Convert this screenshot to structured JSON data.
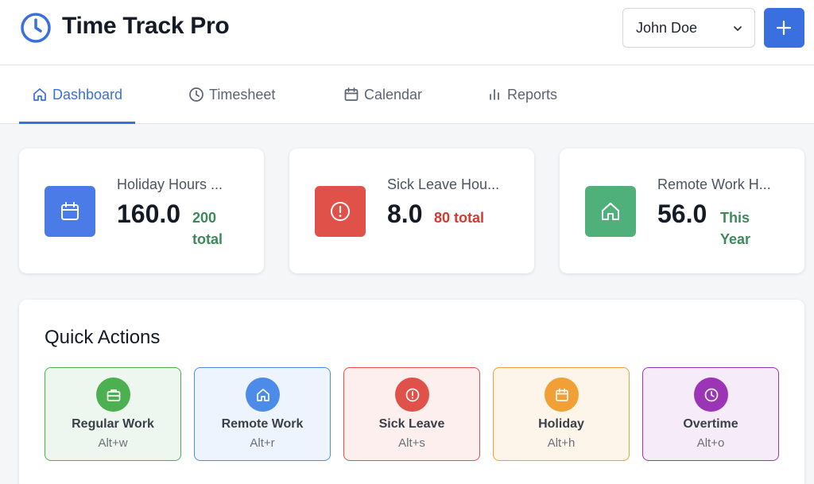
{
  "app": {
    "title": "Time Track Pro"
  },
  "header": {
    "user_select": {
      "value": "John Doe"
    },
    "add_button": {
      "icon": "plus-icon"
    }
  },
  "nav": {
    "tabs": [
      {
        "label": "Dashboard",
        "icon": "home-icon",
        "active": true
      },
      {
        "label": "Timesheet",
        "icon": "clock-icon",
        "active": false
      },
      {
        "label": "Calendar",
        "icon": "calendar-icon",
        "active": false
      },
      {
        "label": "Reports",
        "icon": "bar-chart-icon",
        "active": false
      }
    ]
  },
  "stats": [
    {
      "label": "Holiday Hours ...",
      "value": "160.0",
      "sub": "200 total",
      "icon": "calendar-icon",
      "color": "#4a7be6",
      "sub_color": "#3c8a5c"
    },
    {
      "label": "Sick Leave Hou...",
      "value": "8.0",
      "sub": "80 total",
      "icon": "alert-circle-icon",
      "color": "#e0514a",
      "sub_color": "#d33b32"
    },
    {
      "label": "Remote Work H...",
      "value": "56.0",
      "sub": "This Year",
      "icon": "home-icon",
      "color": "#4fb07a",
      "sub_color": "#3c8a5c"
    }
  ],
  "quick_actions": {
    "title": "Quick Actions",
    "items": [
      {
        "label": "Regular Work",
        "shortcut": "Alt+w",
        "icon": "briefcase-icon",
        "color": "#4caf50",
        "bg": "#eef7ef"
      },
      {
        "label": "Remote Work",
        "shortcut": "Alt+r",
        "icon": "home-icon",
        "color": "#4d8be8",
        "bg": "#edf4fd"
      },
      {
        "label": "Sick Leave",
        "shortcut": "Alt+s",
        "icon": "alert-circle-icon",
        "color": "#e0514a",
        "bg": "#fcefee"
      },
      {
        "label": "Holiday",
        "shortcut": "Alt+h",
        "icon": "calendar-icon",
        "color": "#f0a035",
        "bg": "#fef5ea"
      },
      {
        "label": "Overtime",
        "shortcut": "Alt+o",
        "icon": "clock-icon",
        "color": "#9b35b5",
        "bg": "#f6ecf9"
      }
    ]
  },
  "colors": {
    "accent": "#3a6fe0"
  }
}
